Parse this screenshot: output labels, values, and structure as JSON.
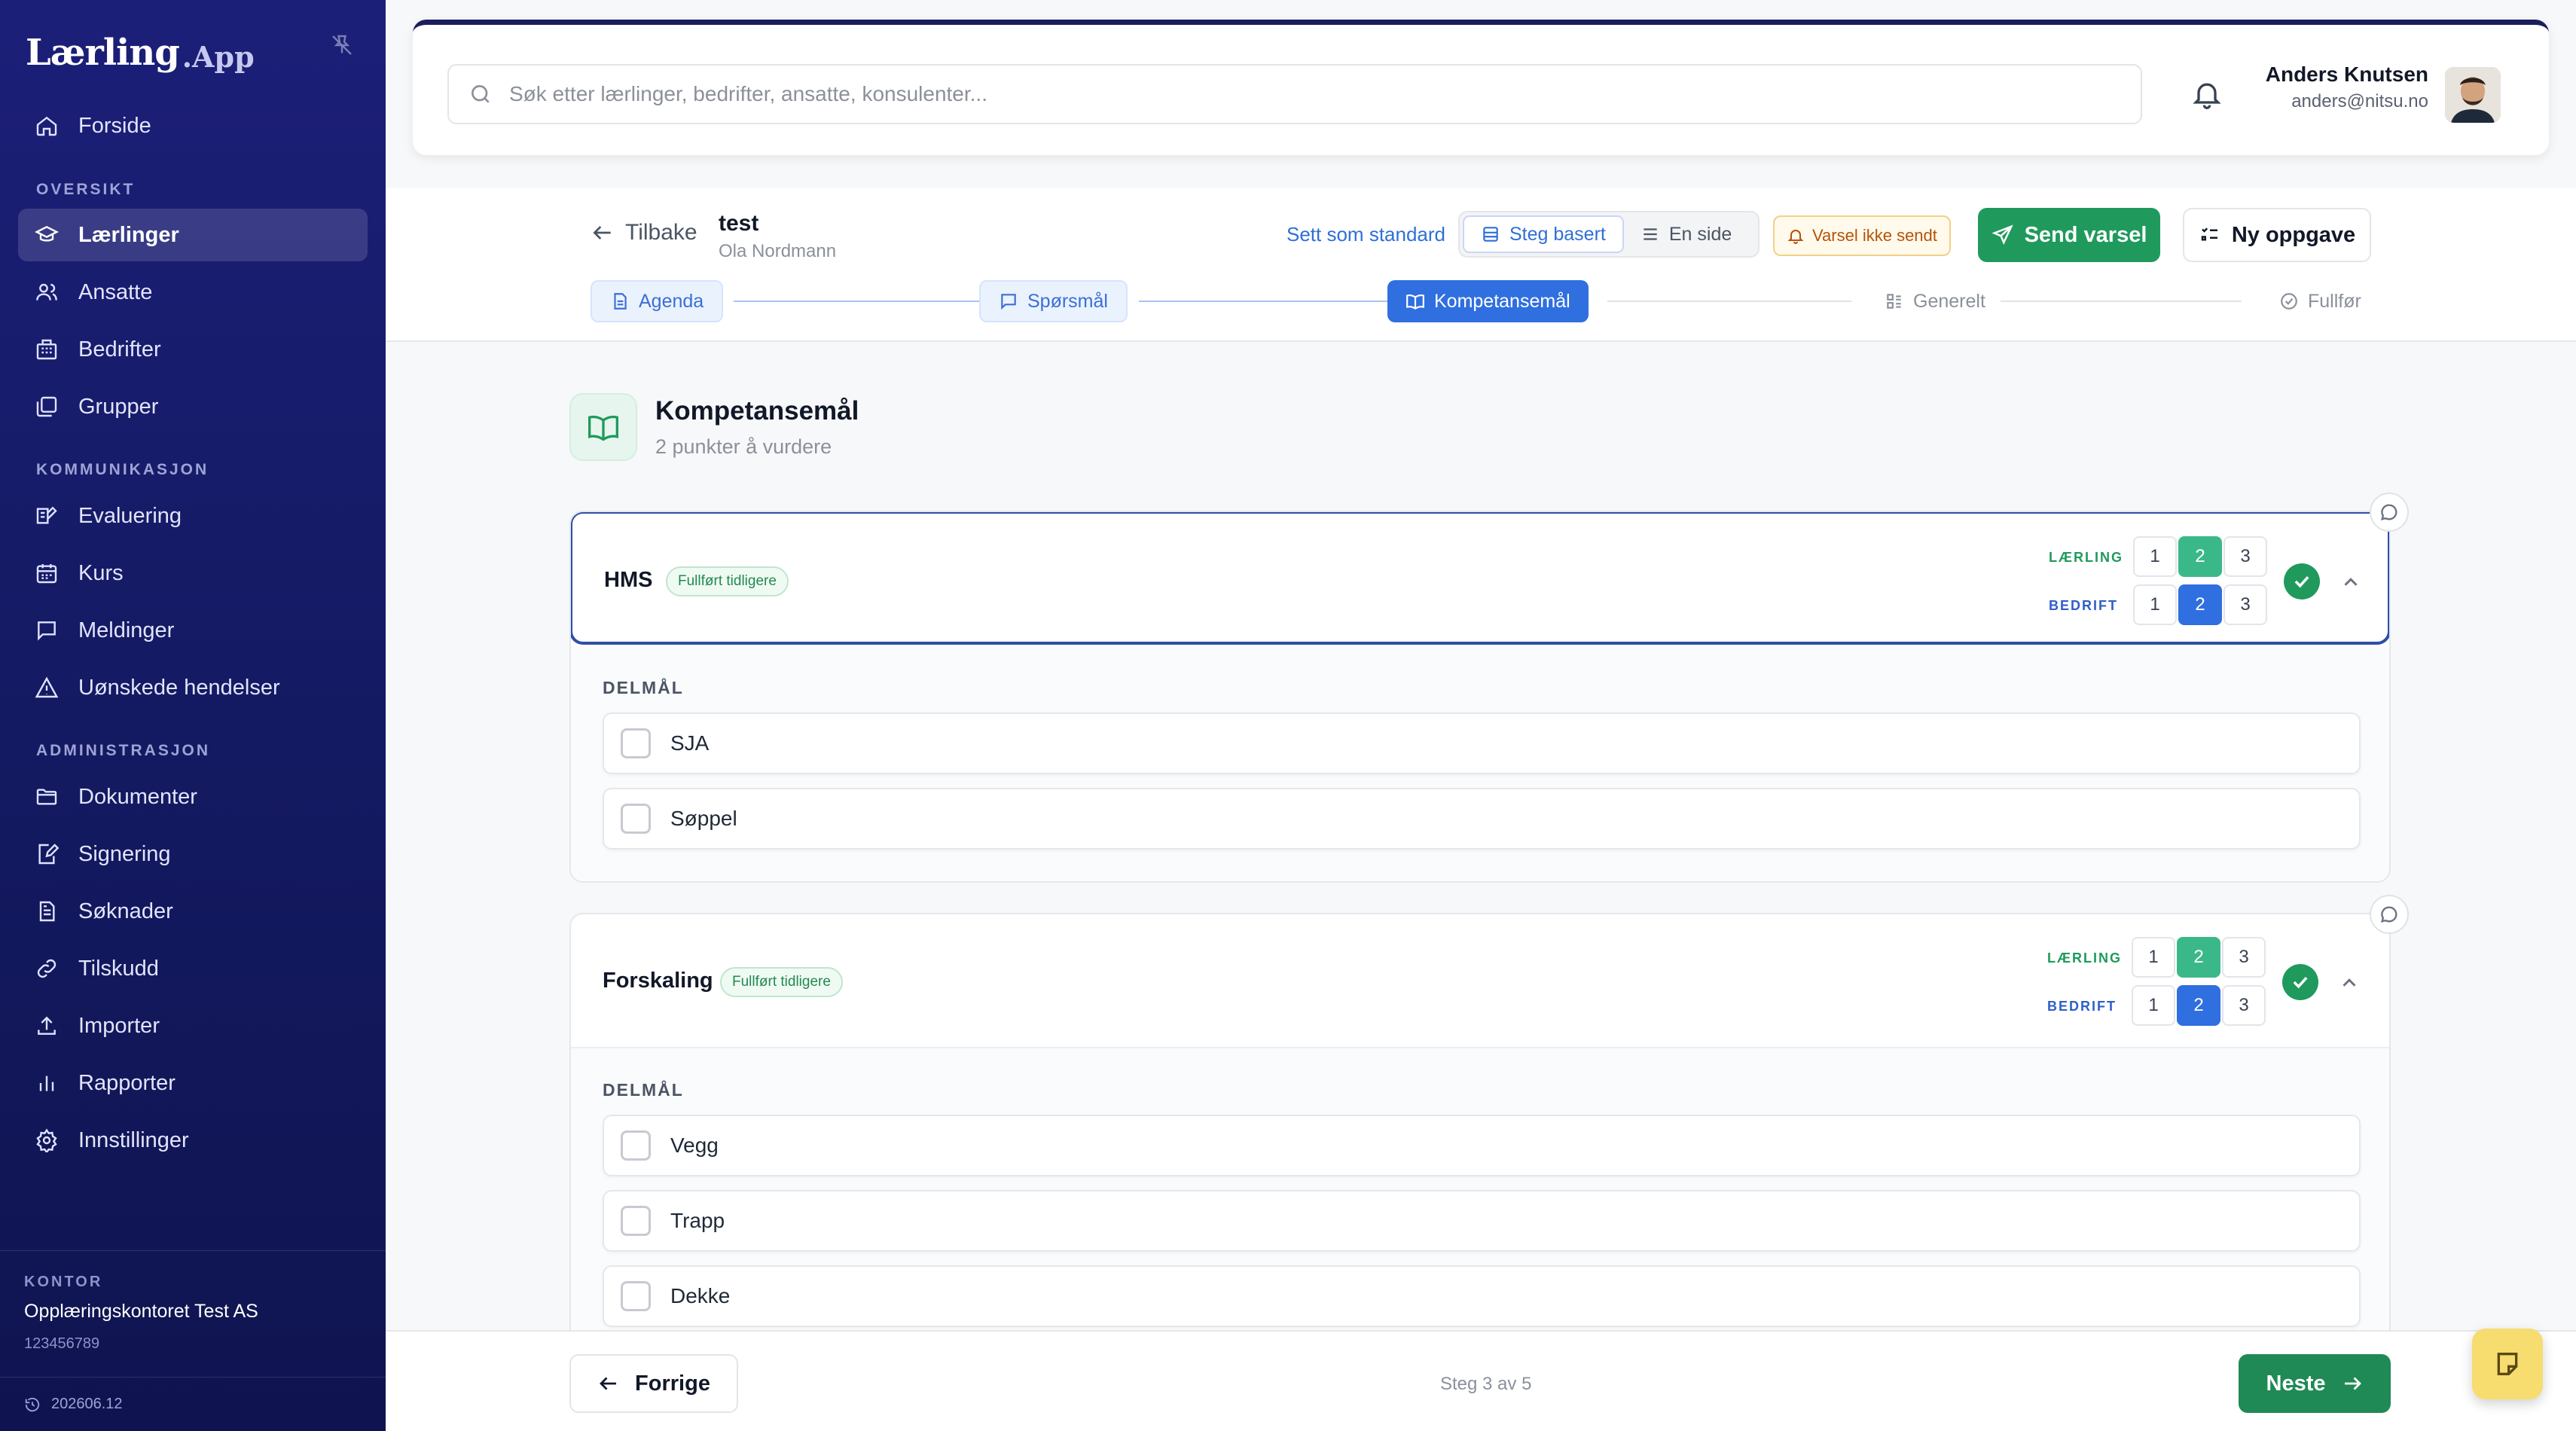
{
  "brand": {
    "name_main": "Lærling",
    "name_suffix": ".App"
  },
  "sidebar": {
    "home": "Forside",
    "sections": [
      {
        "title": "OVERSIKT",
        "items": [
          "Lærlinger",
          "Ansatte",
          "Bedrifter",
          "Grupper"
        ]
      },
      {
        "title": "KOMMUNIKASJON",
        "items": [
          "Evaluering",
          "Kurs",
          "Meldinger",
          "Uønskede hendelser"
        ]
      },
      {
        "title": "ADMINISTRASJON",
        "items": [
          "Dokumenter",
          "Signering",
          "Søknader",
          "Tilskudd",
          "Importer",
          "Rapporter",
          "Innstillinger"
        ]
      }
    ],
    "active_item": "Lærlinger",
    "office": {
      "label": "KONTOR",
      "name": "Opplæringskontoret Test AS",
      "org_number": "123456789"
    },
    "version": "202606.12"
  },
  "search": {
    "placeholder": "Søk etter lærlinger, bedrifter, ansatte, konsulenter..."
  },
  "user": {
    "name": "Anders Knutsen",
    "email": "anders@nitsu.no"
  },
  "wizard": {
    "back_label": "Tilbake",
    "title": "test",
    "subtitle": "Ola Nordmann",
    "set_default": "Sett som standard",
    "view_toggle": {
      "step_based": "Steg basert",
      "single_page": "En side"
    },
    "alert_status": "Varsel ikke sendt",
    "send_alert": "Send varsel",
    "new_task": "Ny oppgave",
    "steps": [
      {
        "label": "Agenda",
        "state": "done",
        "icon": "document-icon"
      },
      {
        "label": "Spørsmål",
        "state": "done",
        "icon": "chat-icon"
      },
      {
        "label": "Kompetansemål",
        "state": "current",
        "icon": "book-icon"
      },
      {
        "label": "Generelt",
        "state": "todo",
        "icon": "grid-icon"
      },
      {
        "label": "Fullfør",
        "state": "todo",
        "icon": "check-circle-icon"
      }
    ]
  },
  "section": {
    "title": "Kompetansemål",
    "subtitle": "2 punkter å vurdere"
  },
  "competencies": [
    {
      "name": "HMS",
      "badge": "Fullført tidligere",
      "apprentice_label": "LÆRLING",
      "company_label": "BEDRIFT",
      "scale": [
        "1",
        "2",
        "3"
      ],
      "apprentice_score": 2,
      "company_score": 2,
      "subgoals_label": "DELMÅL",
      "subgoals": [
        "SJA",
        "Søppel"
      ]
    },
    {
      "name": "Forskaling",
      "badge": "Fullført tidligere",
      "apprentice_label": "LÆRLING",
      "company_label": "BEDRIFT",
      "scale": [
        "1",
        "2",
        "3"
      ],
      "apprentice_score": 2,
      "company_score": 2,
      "subgoals_label": "DELMÅL",
      "subgoals": [
        "Vegg",
        "Trapp",
        "Dekke"
      ]
    }
  ],
  "footer": {
    "prev": "Forrige",
    "step_text": "Steg 3 av 5",
    "next": "Neste"
  },
  "colors": {
    "sidebar": "#1c1f78",
    "primary_blue": "#2f6fe0",
    "success_green": "#1f9a5c",
    "teal": "#3bb88a",
    "note_yellow": "#f7dc6f"
  }
}
